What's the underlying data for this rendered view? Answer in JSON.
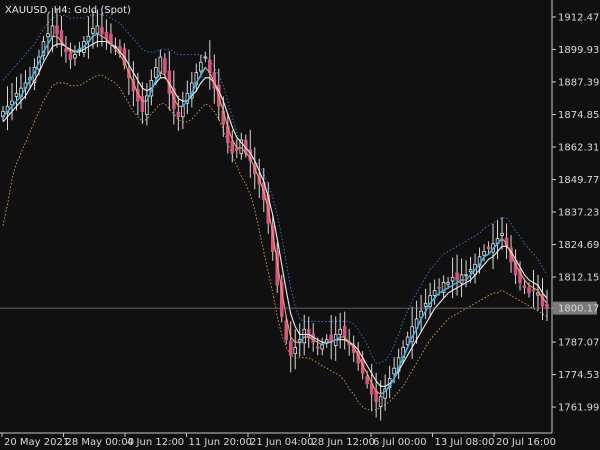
{
  "window": {
    "symbol_title": "XAUUSD, H4:  Gold (Spot)"
  },
  "colors": {
    "background": "#101010",
    "frame": "#c8c8c8",
    "bull_body": "#101010",
    "bull_outline": "#e0e0e0",
    "bear_body": "#d6557e",
    "wick": "#d8d8d8",
    "price_line": "#7a7a7a",
    "price_label_bg": "#7a7a7a",
    "fast_line": "#3ab0e8",
    "mid_line": "#f0a070",
    "slow_line": "#f0f0f0",
    "dotted_blue": "#3a7ad8",
    "dotted_orange": "#e8a040"
  },
  "chart_data": {
    "type": "candlestick",
    "ylim": [
      1752.0,
      1919.0
    ],
    "y_ticks": [
      "1912.47",
      "1899.93",
      "1887.39",
      "1874.85",
      "1862.31",
      "1849.77",
      "1837.23",
      "1824.69",
      "1812.15",
      "1800.17",
      "1787.07",
      "1774.53",
      "1761.99"
    ],
    "x_ticks": [
      "20 May 2021",
      "28 May 00:00",
      "4 Jun 12:00",
      "11 Jun 20:00",
      "21 Jun 04:00",
      "28 Jun 12:00",
      "6 Jul 00:00",
      "13 Jul 08:00",
      "20 Jul 16:00"
    ],
    "current_price": "1800.17",
    "series": [
      {
        "role": "price_approx_close",
        "values": [
          1876,
          1878,
          1880,
          1883,
          1885,
          1887,
          1889,
          1893,
          1897,
          1903,
          1906,
          1909,
          1906,
          1902,
          1899,
          1896,
          1898,
          1900,
          1903,
          1905,
          1908,
          1909,
          1906,
          1904,
          1902,
          1901,
          1899,
          1894,
          1889,
          1884,
          1880,
          1876,
          1882,
          1888,
          1893,
          1897,
          1891,
          1883,
          1877,
          1874,
          1878,
          1883,
          1887,
          1891,
          1895,
          1897,
          1891,
          1885,
          1878,
          1871,
          1864,
          1860,
          1861,
          1865,
          1860,
          1857,
          1852,
          1848,
          1842,
          1833,
          1822,
          1809,
          1797,
          1788,
          1782,
          1785,
          1788,
          1792,
          1789,
          1787,
          1785,
          1786,
          1788,
          1787,
          1790,
          1792,
          1789,
          1786,
          1783,
          1779,
          1775,
          1771,
          1767,
          1764,
          1766,
          1769,
          1773,
          1777,
          1781,
          1785,
          1789,
          1793,
          1796,
          1799,
          1802,
          1805,
          1807,
          1808,
          1810,
          1810,
          1812,
          1811,
          1813,
          1813,
          1815,
          1817,
          1820,
          1822,
          1823,
          1825,
          1827,
          1829,
          1824,
          1818,
          1813,
          1810,
          1808,
          1806,
          1807,
          1806,
          1801,
          1800
        ]
      },
      {
        "role": "fast_ma",
        "values": [
          1874,
          1876,
          1878,
          1880,
          1882,
          1885,
          1888,
          1891,
          1895,
          1899,
          1902,
          1905,
          1905,
          1903,
          1901,
          1899,
          1899,
          1900,
          1901,
          1903,
          1905,
          1906,
          1905,
          1904,
          1902,
          1900,
          1898,
          1895,
          1891,
          1887,
          1883,
          1880,
          1880,
          1884,
          1888,
          1891,
          1890,
          1886,
          1881,
          1878,
          1878,
          1880,
          1883,
          1887,
          1890,
          1893,
          1891,
          1887,
          1882,
          1876,
          1870,
          1865,
          1862,
          1862,
          1860,
          1858,
          1854,
          1850,
          1845,
          1838,
          1829,
          1818,
          1807,
          1797,
          1789,
          1787,
          1787,
          1789,
          1789,
          1788,
          1787,
          1786,
          1787,
          1787,
          1788,
          1789,
          1789,
          1787,
          1785,
          1782,
          1778,
          1775,
          1771,
          1768,
          1767,
          1768,
          1770,
          1773,
          1777,
          1781,
          1785,
          1789,
          1792,
          1796,
          1799,
          1802,
          1804,
          1806,
          1807,
          1808,
          1809,
          1810,
          1811,
          1811,
          1813,
          1815,
          1817,
          1820,
          1821,
          1823,
          1825,
          1827,
          1825,
          1821,
          1817,
          1814,
          1811,
          1809,
          1808,
          1807,
          1804,
          1802
        ]
      },
      {
        "role": "slow_ma",
        "values": [
          1872,
          1874,
          1876,
          1878,
          1880,
          1882,
          1885,
          1888,
          1891,
          1895,
          1898,
          1901,
          1902,
          1902,
          1901,
          1900,
          1899,
          1899,
          1900,
          1901,
          1902,
          1903,
          1903,
          1903,
          1902,
          1901,
          1899,
          1897,
          1894,
          1891,
          1888,
          1885,
          1884,
          1885,
          1887,
          1889,
          1889,
          1887,
          1884,
          1881,
          1880,
          1880,
          1882,
          1884,
          1887,
          1889,
          1889,
          1887,
          1884,
          1880,
          1875,
          1870,
          1866,
          1864,
          1862,
          1860,
          1857,
          1853,
          1849,
          1843,
          1836,
          1827,
          1817,
          1807,
          1798,
          1793,
          1790,
          1790,
          1790,
          1789,
          1788,
          1787,
          1787,
          1787,
          1788,
          1788,
          1788,
          1787,
          1786,
          1784,
          1781,
          1778,
          1775,
          1772,
          1770,
          1770,
          1771,
          1773,
          1776,
          1779,
          1782,
          1785,
          1788,
          1791,
          1794,
          1797,
          1800,
          1802,
          1804,
          1806,
          1807,
          1808,
          1809,
          1810,
          1811,
          1813,
          1815,
          1817,
          1819,
          1820,
          1822,
          1824,
          1824,
          1822,
          1819,
          1816,
          1813,
          1811,
          1810,
          1809,
          1806,
          1804
        ]
      },
      {
        "role": "upper_band",
        "values": [
          1888,
          1890,
          1892,
          1894,
          1896,
          1898,
          1900,
          1902,
          1905,
          1908,
          1910,
          1912,
          1913,
          1913,
          1913,
          1912,
          1912,
          1912,
          1912,
          1913,
          1913,
          1914,
          1913,
          1913,
          1912,
          1911,
          1910,
          1908,
          1906,
          1904,
          1902,
          1900,
          1899,
          1899,
          1899,
          1900,
          1900,
          1900,
          1899,
          1898,
          1898,
          1898,
          1898,
          1898,
          1898,
          1897,
          1896,
          1893,
          1890,
          1886,
          1880,
          1874,
          1868,
          1862,
          1860,
          1859,
          1857,
          1855,
          1852,
          1848,
          1843,
          1836,
          1828,
          1818,
          1808,
          1801,
          1796,
          1795,
          1795,
          1795,
          1795,
          1795,
          1795,
          1795,
          1795,
          1795,
          1795,
          1795,
          1794,
          1792,
          1789,
          1786,
          1782,
          1779,
          1779,
          1780,
          1782,
          1786,
          1790,
          1795,
          1799,
          1803,
          1806,
          1809,
          1812,
          1815,
          1817,
          1819,
          1821,
          1822,
          1823,
          1824,
          1825,
          1826,
          1827,
          1828,
          1829,
          1831,
          1832,
          1833,
          1834,
          1835,
          1835,
          1833,
          1830,
          1828,
          1825,
          1823,
          1821,
          1819,
          1816,
          1813
        ]
      },
      {
        "role": "lower_band",
        "values": [
          1832,
          1840,
          1850,
          1856,
          1860,
          1864,
          1868,
          1872,
          1876,
          1880,
          1883,
          1886,
          1887,
          1887,
          1887,
          1886,
          1886,
          1886,
          1887,
          1888,
          1889,
          1890,
          1890,
          1889,
          1888,
          1887,
          1885,
          1882,
          1879,
          1876,
          1874,
          1872,
          1873,
          1875,
          1877,
          1879,
          1879,
          1877,
          1875,
          1873,
          1872,
          1872,
          1873,
          1875,
          1877,
          1879,
          1878,
          1876,
          1873,
          1869,
          1864,
          1859,
          1855,
          1851,
          1848,
          1844,
          1838,
          1830,
          1822,
          1814,
          1806,
          1797,
          1790,
          1785,
          1782,
          1781,
          1781,
          1781,
          1781,
          1780,
          1779,
          1778,
          1777,
          1776,
          1775,
          1774,
          1772,
          1769,
          1767,
          1764,
          1762,
          1761,
          1761,
          1761,
          1762,
          1763,
          1764,
          1766,
          1768,
          1770,
          1773,
          1776,
          1779,
          1782,
          1785,
          1788,
          1790,
          1792,
          1794,
          1796,
          1797,
          1798,
          1799,
          1800,
          1801,
          1802,
          1803,
          1804,
          1805,
          1806,
          1806,
          1807,
          1806,
          1805,
          1804,
          1803,
          1802,
          1801,
          1800,
          1799,
          1798,
          1797
        ]
      }
    ]
  }
}
